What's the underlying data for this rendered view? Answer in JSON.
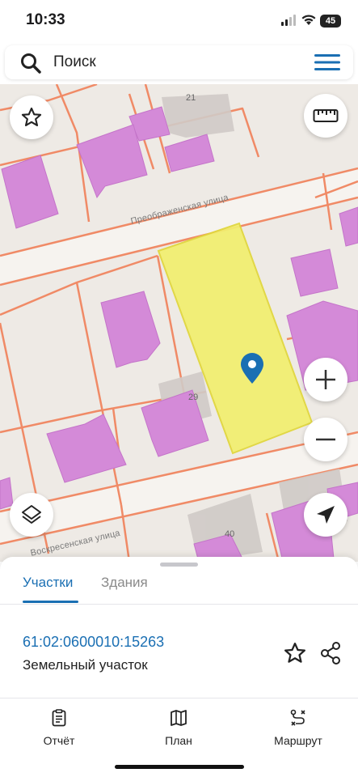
{
  "status_bar": {
    "time": "10:33",
    "battery_level": "45"
  },
  "search": {
    "placeholder": "Поиск"
  },
  "map": {
    "streets": [
      {
        "name": "Преображенская улица"
      },
      {
        "name": "Воскресенская улица"
      }
    ],
    "house_numbers": [
      "21",
      "29",
      "40"
    ],
    "selected_parcel_color": "#f2ef6e",
    "building_color": "#d48ad8",
    "boundary_color": "#f08a66",
    "controls": [
      "favorite",
      "ruler",
      "zoom-in",
      "zoom-out",
      "layers",
      "my-location"
    ]
  },
  "sheet": {
    "tabs": [
      {
        "label": "Участки",
        "active": true
      },
      {
        "label": "Здания",
        "active": false
      }
    ],
    "parcel": {
      "cadastral_number": "61:02:0600010:15263",
      "type": "Земельный участок"
    }
  },
  "bottom_nav": {
    "items": [
      {
        "label": "Отчёт",
        "icon": "report-icon"
      },
      {
        "label": "План",
        "icon": "map-plan-icon"
      },
      {
        "label": "Маршрут",
        "icon": "route-icon"
      }
    ]
  },
  "colors": {
    "accent": "#1a6fb3"
  }
}
